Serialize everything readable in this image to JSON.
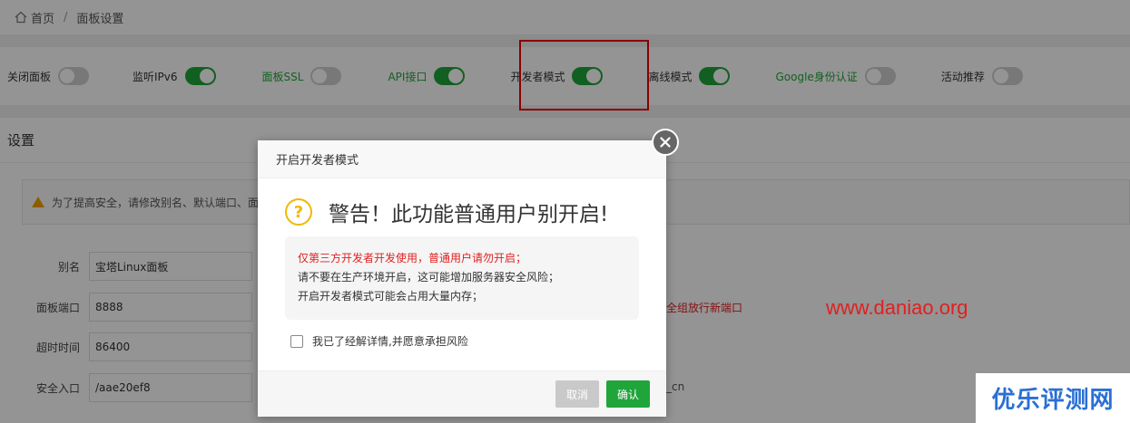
{
  "breadcrumb": {
    "home": "首页",
    "current": "面板设置"
  },
  "toggles": [
    {
      "label": "关闭面板",
      "on": false,
      "color": "#333"
    },
    {
      "label": "监听IPv6",
      "on": true,
      "color": "#333"
    },
    {
      "label": "面板SSL",
      "on": false,
      "color": "#20a53a"
    },
    {
      "label": "API接口",
      "on": true,
      "color": "#20a53a"
    },
    {
      "label": "开发者模式",
      "on": true,
      "color": "#333"
    },
    {
      "label": "离线模式",
      "on": true,
      "color": "#333"
    },
    {
      "label": "Google身份认证",
      "on": false,
      "color": "#20a53a"
    },
    {
      "label": "活动推荐",
      "on": false,
      "color": "#333"
    }
  ],
  "settings": {
    "title": "设置",
    "notice": "为了提高安全，请修改别名、默认端口、面",
    "rows": [
      {
        "label": "别名",
        "value": "宝塔Linux面板"
      },
      {
        "label": "面板端口",
        "value": "8888"
      },
      {
        "label": "超时时间",
        "value": "86400"
      },
      {
        "label": "安全入口",
        "value": "/aae20ef8"
      }
    ],
    "port_note": "全组放行新端口",
    "lang_note": "_cn"
  },
  "dialog": {
    "title": "开启开发者模式",
    "warning": "警告！此功能普通用户别开启!",
    "lines": {
      "red": "仅第三方开发者开发使用，普通用户请勿开启；",
      "l2": "请不要在生产环境开启，这可能增加服务器安全风险；",
      "l3": "开启开发者模式可能会占用大量内存；"
    },
    "consent": "我已了经解详情,并愿意承担风险",
    "cancel": "取消",
    "confirm": "确认"
  },
  "watermark": {
    "url": "www.daniao.org",
    "brand": "优乐评测网"
  },
  "colors": {
    "accent": "#20a53a",
    "danger": "#e02020",
    "brand": "#2a6fd6"
  }
}
